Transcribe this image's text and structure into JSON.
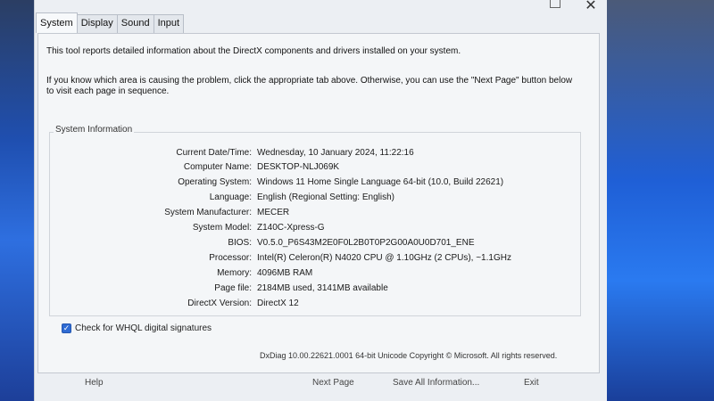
{
  "tabs": [
    "System",
    "Display",
    "Sound",
    "Input"
  ],
  "intro": {
    "line1": "This tool reports detailed information about the DirectX components and drivers installed on your system.",
    "line2": "If you know which area is causing the problem, click the appropriate tab above. Otherwise, you can use the \"Next Page\" button below to visit each page in sequence."
  },
  "group_title": "System Information",
  "info": [
    {
      "label": "Current Date/Time:",
      "value": "Wednesday, 10 January 2024, 11:22:16"
    },
    {
      "label": "Computer Name:",
      "value": "DESKTOP-NLJ069K"
    },
    {
      "label": "Operating System:",
      "value": "Windows 11 Home Single Language 64-bit (10.0, Build 22621)"
    },
    {
      "label": "Language:",
      "value": "English (Regional Setting: English)"
    },
    {
      "label": "System Manufacturer:",
      "value": "MECER"
    },
    {
      "label": "System Model:",
      "value": "Z140C-Xpress-G"
    },
    {
      "label": "BIOS:",
      "value": "V0.5.0_P6S43M2E0F0L2B0T0P2G00A0U0D701_ENE"
    },
    {
      "label": "Processor:",
      "value": "Intel(R) Celeron(R) N4020 CPU @ 1.10GHz (2 CPUs), ~1.1GHz"
    },
    {
      "label": "Memory:",
      "value": "4096MB RAM"
    },
    {
      "label": "Page file:",
      "value": "2184MB used, 3141MB available"
    },
    {
      "label": "DirectX Version:",
      "value": "DirectX 12"
    }
  ],
  "whql_label": "Check for WHQL digital signatures",
  "whql_checked": true,
  "footer": "DxDiag 10.00.22621.0001 64-bit Unicode  Copyright © Microsoft. All rights reserved.",
  "buttons": {
    "help": "Help",
    "next": "Next Page",
    "save": "Save All Information...",
    "exit": "Exit"
  },
  "title_bar": {
    "close": "✕"
  }
}
